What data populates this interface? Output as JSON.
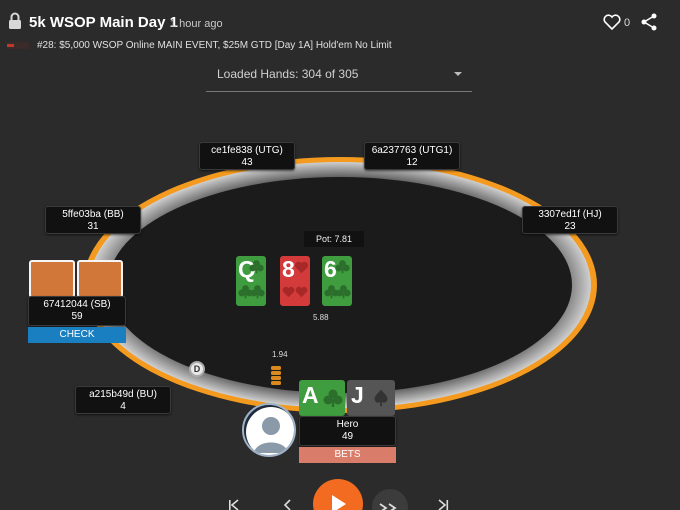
{
  "header": {
    "title": "5k WSOP Main Day 1",
    "time_ago": "1 hour ago",
    "likes": "0",
    "subtitle": "#28: $5,000 WSOP Online MAIN EVENT, $25M GTD [Day 1A] Hold'em No Limit"
  },
  "hands_select": {
    "label": "Loaded Hands: 304 of 305"
  },
  "pot": "Pot: 7.81",
  "board": [
    {
      "rank": "Q",
      "suit": "clubs",
      "color": "#3f9c3f"
    },
    {
      "rank": "8",
      "suit": "hearts",
      "color": "#d33b3b"
    },
    {
      "rank": "6",
      "suit": "clubs",
      "color": "#3f9c3f"
    }
  ],
  "board_bet": "5.88",
  "hero_bet": "1.94",
  "seats": {
    "utg": {
      "name": "ce1fe838 (UTG)",
      "stack": "43"
    },
    "utg1": {
      "name": "6a237763 (UTG1)",
      "stack": "12"
    },
    "bb": {
      "name": "5ffe03ba (BB)",
      "stack": "31"
    },
    "hj": {
      "name": "3307ed1f (HJ)",
      "stack": "23"
    },
    "sb": {
      "name": "67412044 (SB)",
      "stack": "59",
      "action": "CHECK"
    },
    "bu": {
      "name": "a215b49d (BU)",
      "stack": "4"
    },
    "hero": {
      "name": "Hero",
      "stack": "49",
      "action": "BETS"
    }
  },
  "hero_cards": [
    {
      "rank": "A",
      "suit": "clubs",
      "color": "#3f9c3f"
    },
    {
      "rank": "J",
      "suit": "spades",
      "color": "#555555"
    }
  ],
  "dealer_button": "D",
  "colors": {
    "background": "#2b2b2b",
    "table_rail": "#f39a1f",
    "felt": "#1b1b1b",
    "check": "#1a7fc1",
    "bets": "#d97d6a",
    "play": "#f26b21"
  }
}
